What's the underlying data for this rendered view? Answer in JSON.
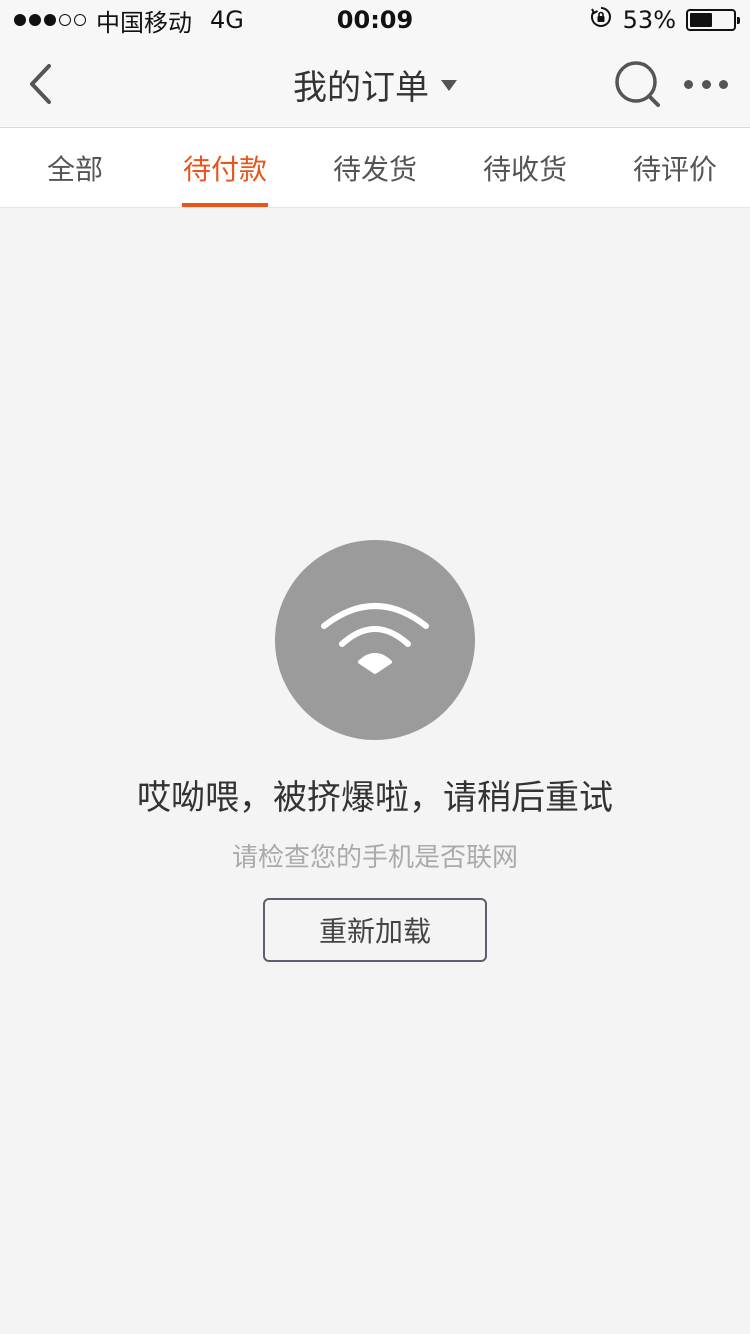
{
  "status_bar": {
    "carrier": "中国移动",
    "network": "4G",
    "time": "00:09",
    "battery_percent": "53%",
    "battery_level": 0.53
  },
  "nav": {
    "title": "我的订单"
  },
  "tabs": [
    {
      "label": "全部",
      "active": false
    },
    {
      "label": "待付款",
      "active": true
    },
    {
      "label": "待发货",
      "active": false
    },
    {
      "label": "待收货",
      "active": false
    },
    {
      "label": "待评价",
      "active": false
    }
  ],
  "error": {
    "title": "哎呦喂，被挤爆啦，请稍后重试",
    "subtitle": "请检查您的手机是否联网",
    "reload_label": "重新加载"
  },
  "colors": {
    "accent": "#e8561b",
    "icon_circle": "#9b9b9b",
    "background": "#f4f4f4"
  }
}
